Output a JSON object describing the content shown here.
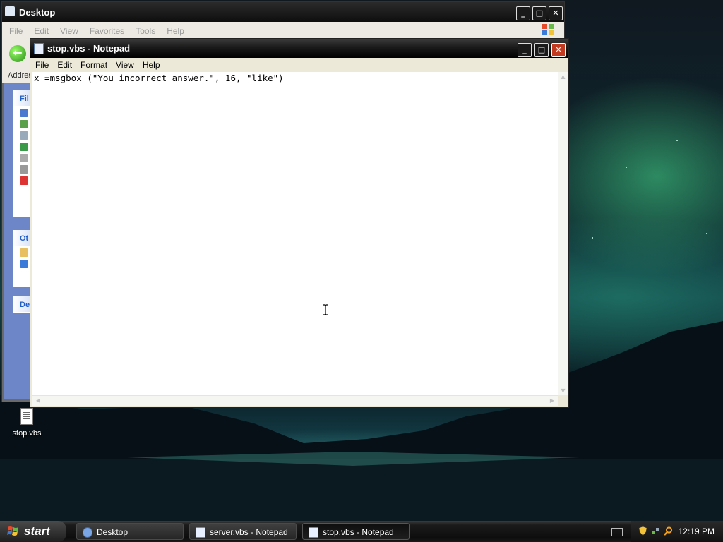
{
  "explorer": {
    "title": "Desktop",
    "menu": [
      "File",
      "Edit",
      "View",
      "Favorites",
      "Tools",
      "Help"
    ],
    "address_label": "Addres",
    "panels": [
      "Fil",
      "Ot",
      "De"
    ]
  },
  "notepad": {
    "title": "stop.vbs - Notepad",
    "menu": [
      "File",
      "Edit",
      "Format",
      "View",
      "Help"
    ],
    "content": "x =msgbox (\"You incorrect answer.\", 16, \"like\")"
  },
  "desktop_icon": {
    "label": "stop.vbs",
    "icon": "text-document-icon"
  },
  "taskbar": {
    "start_label": "start",
    "buttons": [
      {
        "label": "Desktop",
        "icon": "ie-folder-icon",
        "active": false
      },
      {
        "label": "server.vbs - Notepad",
        "icon": "notepad-icon",
        "active": false
      },
      {
        "label": "stop.vbs - Notepad",
        "icon": "notepad-icon",
        "active": true
      }
    ],
    "clock": "12:19 PM"
  },
  "colors": {
    "titlebar": "#1a1a1a",
    "close_button": "#c23a1f",
    "taskbar": "#141414"
  }
}
